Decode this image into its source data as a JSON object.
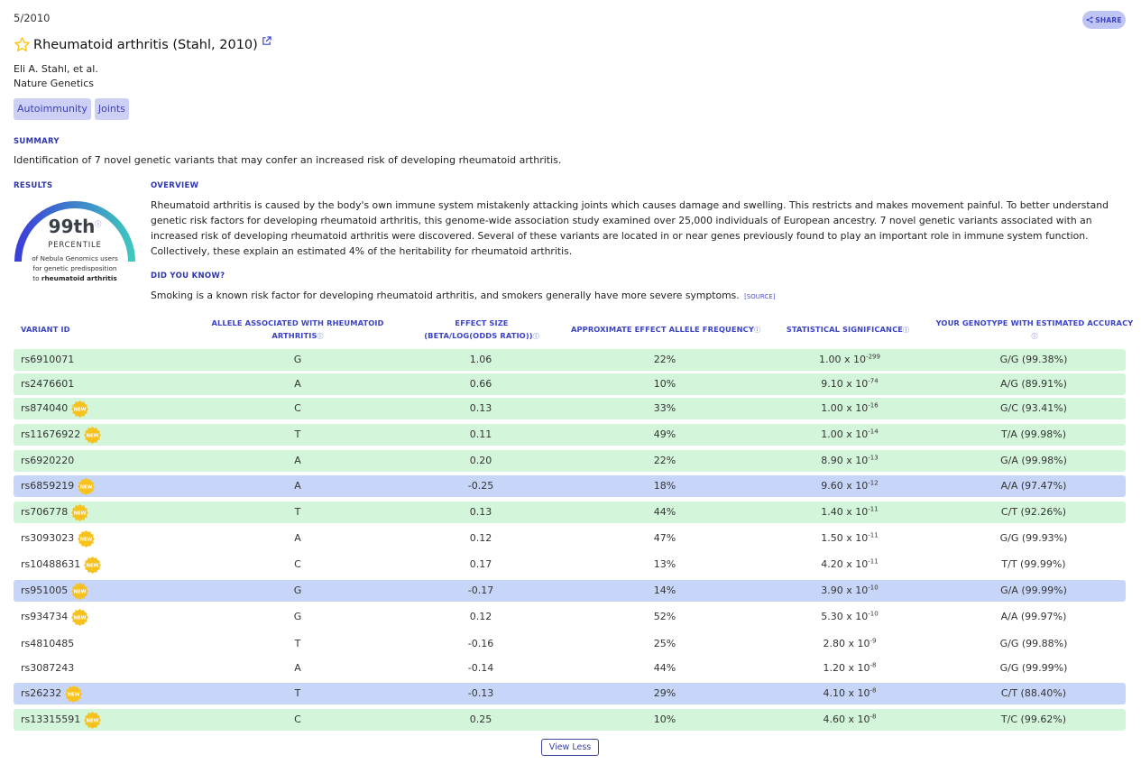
{
  "header": {
    "date": "5/2010",
    "share_label": "SHARE",
    "title": "Rheumatoid arthritis (Stahl, 2010)",
    "authors": "Eli A. Stahl, et al.",
    "journal": "Nature Genetics",
    "tags": [
      "Autoimmunity",
      "Joints"
    ]
  },
  "summary": {
    "label": "SUMMARY",
    "text": "Identification of 7 novel genetic variants that may confer an increased risk of developing rheumatoid arthritis."
  },
  "results": {
    "label": "RESULTS",
    "percentile_value": "99th",
    "percentile_word": "PERCENTILE",
    "percentile_fill": 0.99,
    "desc_line1": "of Nebula Genomics users",
    "desc_line2": "for genetic predisposition",
    "desc_line3_prefix": "to",
    "desc_line3_bold": "rheumatoid arthritis"
  },
  "overview": {
    "label": "OVERVIEW",
    "text": "Rheumatoid arthritis is caused by the body's own immune system mistakenly attacking joints which causes damage and swelling. This restricts and makes movement painful. To better understand genetic risk factors for developing rheumatoid arthritis, this genome-wide association study examined over 25,000 individuals of European ancestry. 7 novel genetic variants associated with an increased risk of developing rheumatoid arthritis were discovered. Several of these variants are located in or near genes previously found to play an important role in immune system function. Collectively, these explain an estimated 4% of the heritability for rheumatoid arthritis."
  },
  "did_you_know": {
    "label": "DID YOU KNOW?",
    "text": "Smoking is a known risk factor for developing rheumatoid arthritis, and smokers generally have more severe symptoms.",
    "source_label": "[SOURCE]"
  },
  "table": {
    "headers": {
      "variant": "VARIANT ID",
      "allele_l1": "ALLELE ASSOCIATED WITH RHEUMATOID",
      "allele_l2": "ARTHRITIS",
      "effect_l1": "EFFECT SIZE",
      "effect_l2": "(BETA/LOG(ODDS RATIO))",
      "freq": "APPROXIMATE EFFECT ALLELE FREQUENCY",
      "sig": "STATISTICAL SIGNIFICANCE",
      "geno": "YOUR GENOTYPE WITH ESTIMATED ACCURACY"
    },
    "info_glyph": "ⓘ",
    "new_badge": "NEW",
    "row_colors": {
      "green": "#d3f5da",
      "blue": "#c7d6f8",
      "white": "#ffffff"
    },
    "rows": [
      {
        "id": "rs6910071",
        "new": false,
        "allele": "G",
        "effect": "1.06",
        "freq": "22%",
        "sig_base": "1.00 x 10",
        "sig_exp": "-299",
        "geno": "G/G (99.38%)",
        "color": "green"
      },
      {
        "id": "rs2476601",
        "new": false,
        "allele": "A",
        "effect": "0.66",
        "freq": "10%",
        "sig_base": "9.10 x 10",
        "sig_exp": "-74",
        "geno": "A/G (89.91%)",
        "color": "green"
      },
      {
        "id": "rs874040",
        "new": true,
        "allele": "C",
        "effect": "0.13",
        "freq": "33%",
        "sig_base": "1.00 x 10",
        "sig_exp": "-16",
        "geno": "G/C (93.41%)",
        "color": "green"
      },
      {
        "id": "rs11676922",
        "new": true,
        "allele": "T",
        "effect": "0.11",
        "freq": "49%",
        "sig_base": "1.00 x 10",
        "sig_exp": "-14",
        "geno": "T/A (99.98%)",
        "color": "green"
      },
      {
        "id": "rs6920220",
        "new": false,
        "allele": "A",
        "effect": "0.20",
        "freq": "22%",
        "sig_base": "8.90 x 10",
        "sig_exp": "-13",
        "geno": "G/A (99.98%)",
        "color": "green"
      },
      {
        "id": "rs6859219",
        "new": true,
        "allele": "A",
        "effect": "-0.25",
        "freq": "18%",
        "sig_base": "9.60 x 10",
        "sig_exp": "-12",
        "geno": "A/A (97.47%)",
        "color": "blue"
      },
      {
        "id": "rs706778",
        "new": true,
        "allele": "T",
        "effect": "0.13",
        "freq": "44%",
        "sig_base": "1.40 x 10",
        "sig_exp": "-11",
        "geno": "C/T (92.26%)",
        "color": "green"
      },
      {
        "id": "rs3093023",
        "new": true,
        "allele": "A",
        "effect": "0.12",
        "freq": "47%",
        "sig_base": "1.50 x 10",
        "sig_exp": "-11",
        "geno": "G/G (99.93%)",
        "color": "white"
      },
      {
        "id": "rs10488631",
        "new": true,
        "allele": "C",
        "effect": "0.17",
        "freq": "13%",
        "sig_base": "4.20 x 10",
        "sig_exp": "-11",
        "geno": "T/T (99.99%)",
        "color": "white"
      },
      {
        "id": "rs951005",
        "new": true,
        "allele": "G",
        "effect": "-0.17",
        "freq": "14%",
        "sig_base": "3.90 x 10",
        "sig_exp": "-10",
        "geno": "G/A (99.99%)",
        "color": "blue"
      },
      {
        "id": "rs934734",
        "new": true,
        "allele": "G",
        "effect": "0.12",
        "freq": "52%",
        "sig_base": "5.30 x 10",
        "sig_exp": "-10",
        "geno": "A/A (99.97%)",
        "color": "white"
      },
      {
        "id": "rs4810485",
        "new": false,
        "allele": "T",
        "effect": "-0.16",
        "freq": "25%",
        "sig_base": "2.80 x 10",
        "sig_exp": "-9",
        "geno": "G/G (99.88%)",
        "color": "white"
      },
      {
        "id": "rs3087243",
        "new": false,
        "allele": "A",
        "effect": "-0.14",
        "freq": "44%",
        "sig_base": "1.20 x 10",
        "sig_exp": "-8",
        "geno": "G/G (99.99%)",
        "color": "white"
      },
      {
        "id": "rs26232",
        "new": true,
        "allele": "T",
        "effect": "-0.13",
        "freq": "29%",
        "sig_base": "4.10 x 10",
        "sig_exp": "-8",
        "geno": "C/T (88.40%)",
        "color": "blue"
      },
      {
        "id": "rs13315591",
        "new": true,
        "allele": "C",
        "effect": "0.25",
        "freq": "10%",
        "sig_base": "4.60 x 10",
        "sig_exp": "-8",
        "geno": "T/C (99.62%)",
        "color": "green"
      }
    ]
  },
  "view_less_label": "View Less",
  "colors": {
    "accent": "#3b43c7",
    "gauge_start": "#3b3fd8",
    "gauge_end": "#3fc6bd",
    "star": "#f5c518",
    "badge": "#f7c21d"
  }
}
